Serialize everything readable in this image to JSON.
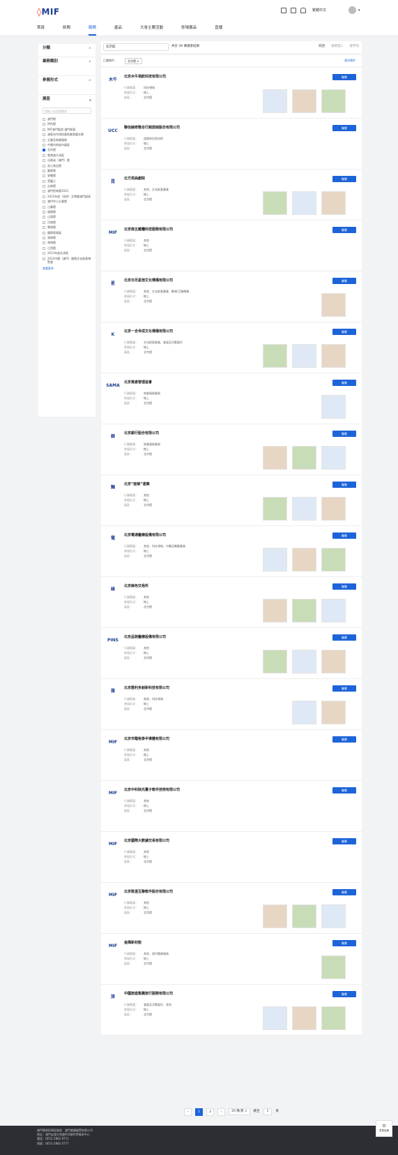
{
  "header": {
    "logo_mark": "◊",
    "logo_text": "MIF",
    "language": "繁體中文"
  },
  "nav": [
    "首頁",
    "新聞",
    "服務",
    "產品",
    "大會主要活動",
    "即場展品",
    "直播"
  ],
  "nav_active": 2,
  "sidebar": {
    "sections": [
      "分類",
      "業務類別",
      "參展形式",
      "展區"
    ],
    "search_placeholder": "請輸入搜索關鍵詞",
    "items": [
      "澳門館",
      "特色館",
      "MIF澳門製造·澳門創意",
      "澳葡合作保稅基地美食嘉年華",
      "企業及商業服務",
      "中國內地省市展區",
      "北京館",
      "粵港澳大灣區",
      "泛珠省（澳門）館",
      "浙江商品館",
      "廣東館",
      "安徽館",
      "黑龍江",
      "吉林館",
      "澳門招商館2022",
      "2022年度（深圳）文博會澳門展區",
      "澳門中小企業館",
      "江蘇館",
      "福建館",
      "山東館",
      "河南館",
      "雲南館",
      "國際經貿展",
      "湖南館",
      "海南館",
      "江西館",
      "2023年度交流區",
      "2023中國（澳門）國際文化創意博覽會"
    ],
    "checked_index": 6,
    "more": "查看更多"
  },
  "toolbar": {
    "search_value": "北京館",
    "total": "共計 39 條搜索結果",
    "sorts": [
      "綜合",
      "按熱度↓",
      "按字母"
    ]
  },
  "filters": {
    "label": "已選條件：",
    "chip": "北京館 ×",
    "clear": "清空條件"
  },
  "labels": {
    "industry": "行業範圍：",
    "form": "參展形式：",
    "hall": "展區："
  },
  "button_label": "聯繫",
  "companies": [
    {
      "name": "北京木牛領航科技有限公司",
      "logo": "木牛",
      "industry": "科技領域",
      "form": "線上",
      "hall": "北京館",
      "thumbs": 3
    },
    {
      "name": "聯信線修整合行銷諮詢股份有限公司",
      "logo": "UCC",
      "industry": "諮詢與信息技術",
      "form": "線上",
      "hall": "北京館",
      "thumbs": 0
    },
    {
      "name": "北方昆曲劇院",
      "logo": "昆",
      "industry": "其他、文化創意產業",
      "form": "線上",
      "hall": "北京館",
      "thumbs": 3
    },
    {
      "name": "北京南五雜糧科技服務有限公司",
      "logo": "MIF",
      "industry": "其他",
      "form": "線上",
      "hall": "北京館",
      "thumbs": 0
    },
    {
      "name": "北京日月星宿文化傳播有限公司",
      "logo": "星",
      "industry": "其他、文化創意產業、數碼/互聯網業",
      "form": "線上",
      "hall": "北京館",
      "thumbs": 1
    },
    {
      "name": "北京一合世成文化傳播有限公司",
      "logo": "K",
      "industry": "文化創意產業、會展及活動製作",
      "form": "線上",
      "hall": "北京館",
      "thumbs": 3
    },
    {
      "name": "北京資產管理協會",
      "logo": "SAMA",
      "industry": "商業服務業務",
      "form": "線上",
      "hall": "北京館",
      "thumbs": 1
    },
    {
      "name": "北京銀行股份有限公司",
      "logo": "銀",
      "industry": "商業服務業務",
      "form": "線上",
      "hall": "北京館",
      "thumbs": 3
    },
    {
      "name": "北京“面條”連鎖",
      "logo": "麵",
      "industry": "其他",
      "form": "線上",
      "hall": "北京館",
      "thumbs": 3
    },
    {
      "name": "北京電通醫療設備有限公司",
      "logo": "電",
      "industry": "其他、科技領域、中醫及醫藥產業",
      "form": "線上",
      "hall": "北京館",
      "thumbs": 3
    },
    {
      "name": "北京綠色交易所",
      "logo": "綠",
      "industry": "其他",
      "form": "線上",
      "hall": "北京館",
      "thumbs": 3
    },
    {
      "name": "北京品驰醫療設備有限公司",
      "logo": "PINS",
      "industry": "其他",
      "form": "線上",
      "hall": "北京館",
      "thumbs": 3
    },
    {
      "name": "北京雅利多創新科技有限公司",
      "logo": "雅",
      "industry": "其他、科技領域",
      "form": "線上",
      "hall": "北京館",
      "thumbs": 2
    },
    {
      "name": "北京市臨裕泰半導體有限公司",
      "logo": "MIF",
      "industry": "其他",
      "form": "線上",
      "hall": "北京館",
      "thumbs": 0
    },
    {
      "name": "北京中科院光量子軟件技術有限公司",
      "logo": "MIF",
      "industry": "其他",
      "form": "線上",
      "hall": "北京館",
      "thumbs": 0
    },
    {
      "name": "北京國際大數據交易有限公司",
      "logo": "MIF",
      "industry": "其他",
      "form": "線上",
      "hall": "北京館",
      "thumbs": 0
    },
    {
      "name": "北京致遠互聯軟件股份有限公司",
      "logo": "MIF",
      "industry": "其他",
      "form": "線上",
      "hall": "北京館",
      "thumbs": 3
    },
    {
      "name": "金隅新材能",
      "logo": "MIF",
      "industry": "其他、現代農業服務",
      "form": "線上",
      "hall": "北京館",
      "thumbs": 1
    },
    {
      "name": "中國旅遊集團旅行服務有限公司",
      "logo": "旅",
      "industry": "會展及活動製作、其他",
      "form": "線上",
      "hall": "北京館",
      "thumbs": 3
    }
  ],
  "pager": {
    "prev": "‹",
    "pages": [
      "1",
      "2"
    ],
    "next": "›",
    "per_page": "20 條/頁 ∨",
    "goto_label": "跳至",
    "goto_value": "1",
    "goto_unit": "頁"
  },
  "footer": {
    "line1": "澳門貿易投資促進局　澳門會議展覽有限公司",
    "line2": "地址：澳門友誼大馬路918號世界貿易中心",
    "line3": "電話：(853) 2882 8711",
    "line4": "傳真：(853) 2882 6777"
  },
  "feedback": "意見反饋"
}
